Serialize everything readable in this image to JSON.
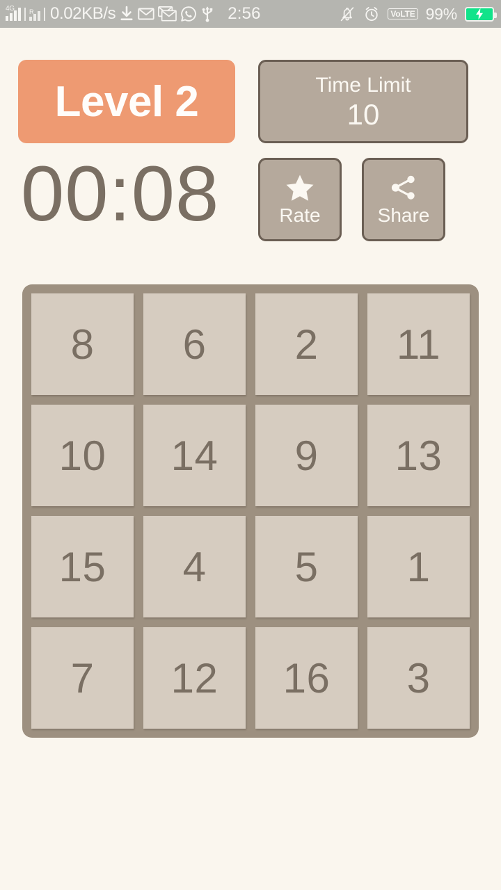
{
  "statusbar": {
    "network_type": "4G",
    "network_type_secondary": "R",
    "net_speed": "0.02KB/s",
    "time": "2:56",
    "volte": "VoLTE",
    "battery_percent": "99%",
    "icons_left": [
      "signal-4g-icon",
      "signal-secondary-icon",
      "download-icon",
      "gmail-icon",
      "gmail-secondary-icon",
      "whatsapp-icon",
      "usb-icon"
    ],
    "icons_right": [
      "silent-bell-icon",
      "alarm-clock-icon",
      "volte-badge",
      "battery-charging-icon"
    ],
    "colors": {
      "bar_bg": "#b5b5b0",
      "text": "#f6f5f2",
      "battery_fill": "#11e38a"
    }
  },
  "header": {
    "level_label": "Level 2",
    "time_limit_label": "Time Limit",
    "time_limit_value": "10",
    "timer": "00:08",
    "rate_label": "Rate",
    "share_label": "Share",
    "rate_icon": "star-icon",
    "share_icon": "share-nodes-icon"
  },
  "board": {
    "rows": [
      [
        "8",
        "6",
        "2",
        "11"
      ],
      [
        "10",
        "14",
        "9",
        "13"
      ],
      [
        "15",
        "4",
        "5",
        "1"
      ],
      [
        "7",
        "12",
        "16",
        "3"
      ]
    ]
  },
  "colors": {
    "page_bg": "#faf6ee",
    "accent": "#ee9a72",
    "button_fill": "#b5a99c",
    "button_border": "#6b5f54",
    "board_bg": "#9d9080",
    "tile_bg": "#d6ccc0",
    "tile_text": "#7a6f63"
  }
}
